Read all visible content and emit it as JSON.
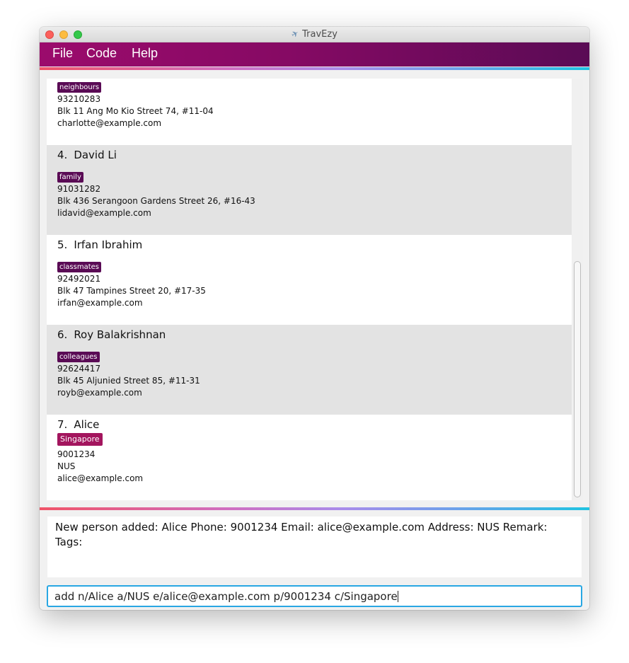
{
  "window": {
    "title": "TravEzy",
    "title_icon": "airplane-icon"
  },
  "menu": {
    "items": [
      "File",
      "Code",
      "Help"
    ]
  },
  "persons": [
    {
      "index": "",
      "name": "",
      "tag": "neighbours",
      "phone": "93210283",
      "address": "Blk 11 Ang Mo Kio Street 74, #11-04",
      "email": "charlotte@example.com"
    },
    {
      "index": "4.",
      "name": "David Li",
      "tag": "family",
      "phone": "91031282",
      "address": "Blk 436 Serangoon Gardens Street 26, #16-43",
      "email": "lidavid@example.com"
    },
    {
      "index": "5.",
      "name": "Irfan Ibrahim",
      "tag": "classmates",
      "phone": "92492021",
      "address": "Blk 47 Tampines Street 20, #17-35",
      "email": "irfan@example.com"
    },
    {
      "index": "6.",
      "name": "Roy Balakrishnan",
      "tag": "colleagues",
      "phone": "92624417",
      "address": "Blk 45 Aljunied Street 85, #11-31",
      "email": "royb@example.com"
    },
    {
      "index": "7.",
      "name": "Alice",
      "tag": "Singapore",
      "phone": "9001234",
      "address": "NUS",
      "email": "alice@example.com"
    }
  ],
  "result": {
    "text": "New person added: Alice Phone: 9001234 Email: alice@example.com Address: NUS Remark: Tags:"
  },
  "command": {
    "value": "add n/Alice a/NUS e/alice@example.com p/9001234 c/Singapore"
  },
  "colors": {
    "menubar": "#860a64",
    "tag": "#5a0b55",
    "tag_highlight": "#a3155e",
    "command_border": "#29a7e3"
  }
}
